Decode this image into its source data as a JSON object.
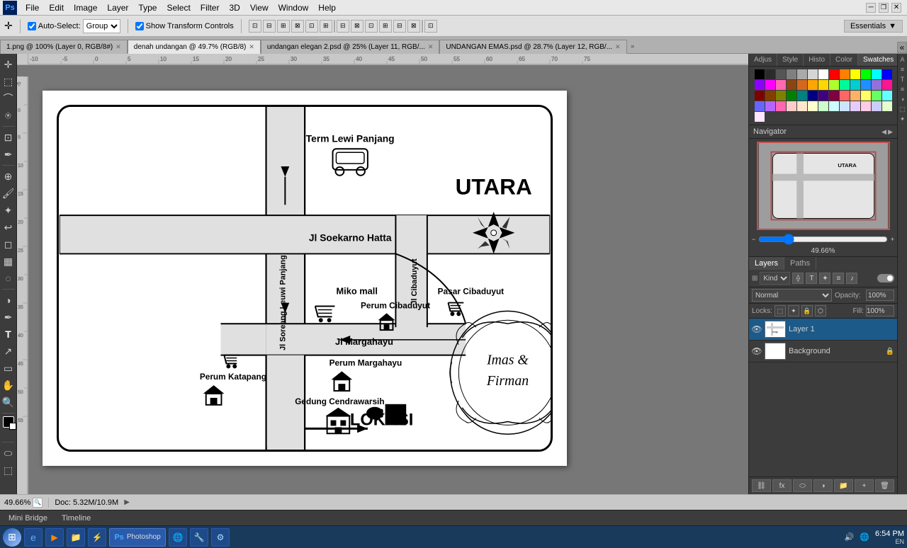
{
  "app": {
    "logo": "Ps",
    "title": "Adobe Photoshop"
  },
  "menubar": {
    "items": [
      "File",
      "Edit",
      "Image",
      "Layer",
      "Type",
      "Select",
      "Filter",
      "3D",
      "View",
      "Window",
      "Help"
    ]
  },
  "toolbar": {
    "auto_select_label": "Auto-Select:",
    "group_select": "Group",
    "show_transform": "Show Transform Controls",
    "essentials": "Essentials"
  },
  "tabs": [
    {
      "label": "1.png @ 100% (Layer 0, RGB/8#)",
      "active": false
    },
    {
      "label": "denah undangan @ 49.7% (RGB/8)",
      "active": true
    },
    {
      "label": "undangan elegan 2.psd @ 25% (Layer 11, RGB/...",
      "active": false
    },
    {
      "label": "UNDANGAN EMAS.psd @ 28.7% (Layer 12, RGB/...",
      "active": false
    }
  ],
  "navigator": {
    "title": "Navigator",
    "zoom_label": "49.66%"
  },
  "top_right_tabs": [
    "Adjustments",
    "Style",
    "Histogram",
    "Color",
    "Swatches"
  ],
  "swatches": {
    "colors": [
      "#000000",
      "#2b2b2b",
      "#555555",
      "#808080",
      "#aaaaaa",
      "#d5d5d5",
      "#ffffff",
      "#ff0000",
      "#ff7f00",
      "#ffff00",
      "#00ff00",
      "#00ffff",
      "#0000ff",
      "#8b00ff",
      "#ff00ff",
      "#ff69b4",
      "#8b4513",
      "#d2691e",
      "#ffa500",
      "#ffd700",
      "#adff2f",
      "#00fa9a",
      "#00ced1",
      "#1e90ff",
      "#9370db",
      "#ff1493",
      "#800000",
      "#804000",
      "#808000",
      "#008000",
      "#008080",
      "#000080",
      "#400080",
      "#800040",
      "#ff6666",
      "#ffb266",
      "#ffff66",
      "#66ff66",
      "#66ffff",
      "#6666ff",
      "#b266ff",
      "#ff66b2",
      "#ffcccc",
      "#ffe5cc",
      "#ffffcc",
      "#ccffcc",
      "#ccffff",
      "#cce5ff",
      "#e5ccff",
      "#ffcce5",
      "#ccccff",
      "#e5ffcc",
      "#ffe5ff"
    ]
  },
  "layers": {
    "mode": "Normal",
    "opacity": "100%",
    "fill": "100%",
    "items": [
      {
        "name": "Layer 1",
        "visible": true,
        "active": true,
        "locked": false,
        "has_thumb": true
      },
      {
        "name": "Background",
        "visible": true,
        "active": false,
        "locked": true,
        "has_thumb": false
      }
    ]
  },
  "map": {
    "title": "UTARA",
    "compass": true,
    "locations": [
      {
        "name": "Term Lewi Panjang",
        "type": "terminal"
      },
      {
        "name": "Jl Soekarno Hatta",
        "type": "road"
      },
      {
        "name": "Miko mall",
        "type": "mall"
      },
      {
        "name": "Perum Cibaduyut",
        "type": "housing"
      },
      {
        "name": "Jl Cibaduyut",
        "type": "road"
      },
      {
        "name": "Pasar Cibaduyut",
        "type": "market"
      },
      {
        "name": "Perum Margahayu",
        "type": "housing"
      },
      {
        "name": "Jl Margahayu",
        "type": "road"
      },
      {
        "name": "Perum Katapang",
        "type": "housing"
      },
      {
        "name": "Gedung Cendrawarsih",
        "type": "building"
      },
      {
        "name": "LOKASI",
        "type": "label"
      }
    ],
    "decoration_text": "Imas & Firman"
  },
  "statusbar": {
    "zoom": "49.66%",
    "doc_info": "Doc: 5.32M/10.9M"
  },
  "bottombar": {
    "tabs": [
      "Mini Bridge",
      "Timeline"
    ]
  },
  "taskbar": {
    "apps": [
      "IE",
      "Media",
      "Folder",
      "Zap",
      "Ps",
      "Globe",
      "Lock"
    ],
    "time": "6:54 PM",
    "lang": "EN"
  }
}
